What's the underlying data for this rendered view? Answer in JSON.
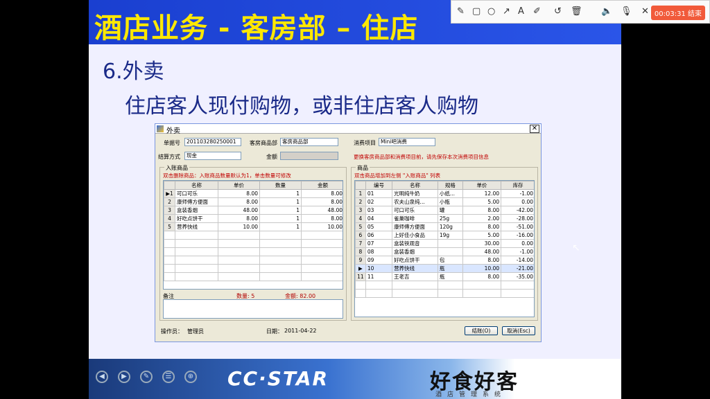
{
  "slide": {
    "title": "酒店业务 - 客房部 – 住店",
    "heading": "6.外卖",
    "subtitle": "住店客人现付购物，或非住店客人购物"
  },
  "window": {
    "title": "外卖",
    "close_label": "✕",
    "order_no_label": "单据号",
    "order_no": "201103280250001",
    "dept_label": "客房商品部",
    "dept_value": "客房商品部",
    "consume_label": "消费项目",
    "consume_value": "Mini吧消费",
    "payment_label": "结算方式",
    "payment_value": "现金",
    "amount_label": "金额",
    "amount_value": "",
    "dept_hint": "更换客房商品部和消费项目前，请先保存本次消费项目信息",
    "left_group_title": "入账商品",
    "left_hint": "双击删除商品：入账商品数量默认为1，单击数量可修改",
    "left_columns": [
      "",
      "名称",
      "单价",
      "数量",
      "金额"
    ],
    "left_rows": [
      {
        "idx": "▶1",
        "name": "可口可乐",
        "price": "8.00",
        "qty": "1",
        "amount": "8.00"
      },
      {
        "idx": "2",
        "name": "康师傅方便面",
        "price": "8.00",
        "qty": "1",
        "amount": "8.00"
      },
      {
        "idx": "3",
        "name": "盒装香烟",
        "price": "48.00",
        "qty": "1",
        "amount": "48.00"
      },
      {
        "idx": "4",
        "name": "好吃点饼干",
        "price": "8.00",
        "qty": "1",
        "amount": "8.00"
      },
      {
        "idx": "5",
        "name": "营养快线",
        "price": "10.00",
        "qty": "1",
        "amount": "10.00"
      }
    ],
    "remark_label": "备注",
    "qty_summary": "数量: 5",
    "amount_summary": "金额: 82.00",
    "right_group_title": "商品",
    "right_hint": "双击商品增加到左侧 \"入账商品\" 列表",
    "right_columns": [
      "",
      "编号",
      "名称",
      "规格",
      "单价",
      "库存"
    ],
    "right_rows": [
      {
        "idx": "1",
        "code": "01",
        "name": "光明纯牛奶",
        "spec": "小纸...",
        "price": "12.00",
        "stock": "-1.00"
      },
      {
        "idx": "2",
        "code": "02",
        "name": "农夫山泉纯...",
        "spec": "小瓶",
        "price": "5.00",
        "stock": "0.00"
      },
      {
        "idx": "3",
        "code": "03",
        "name": "可口可乐",
        "spec": "罐",
        "price": "8.00",
        "stock": "-42.00"
      },
      {
        "idx": "4",
        "code": "04",
        "name": "雀巢咖啡",
        "spec": "25g",
        "price": "2.00",
        "stock": "-28.00"
      },
      {
        "idx": "5",
        "code": "05",
        "name": "康师傅方便面",
        "spec": "120g",
        "price": "8.00",
        "stock": "-51.00"
      },
      {
        "idx": "6",
        "code": "06",
        "name": "上好佳小食品",
        "spec": "19g",
        "price": "5.00",
        "stock": "-16.00"
      },
      {
        "idx": "7",
        "code": "07",
        "name": "盒装铁观音",
        "spec": "",
        "price": "30.00",
        "stock": "0.00"
      },
      {
        "idx": "8",
        "code": "08",
        "name": "盒装香烟",
        "spec": "",
        "price": "48.00",
        "stock": "-1.00"
      },
      {
        "idx": "9",
        "code": "09",
        "name": "好吃点饼干",
        "spec": "包",
        "price": "8.00",
        "stock": "-14.00"
      },
      {
        "idx": "▶",
        "code": "10",
        "name": "营养快线",
        "spec": "瓶",
        "price": "10.00",
        "stock": "-21.00"
      },
      {
        "idx": "11",
        "code": "11",
        "name": "王老吉",
        "spec": "瓶",
        "price": "8.00",
        "stock": "-35.00"
      }
    ],
    "operator_label": "操作员：",
    "operator": "管理员",
    "date_label": "日期：",
    "date": "2011-04-22",
    "checkout_button": "结账(O)",
    "cancel_button": "取消(Esc)"
  },
  "banner": {
    "logo": "CC·STAR",
    "brand": "好食好客",
    "sub": "酒店管理系统"
  },
  "recorder": {
    "time": "00:03:31 结束"
  }
}
